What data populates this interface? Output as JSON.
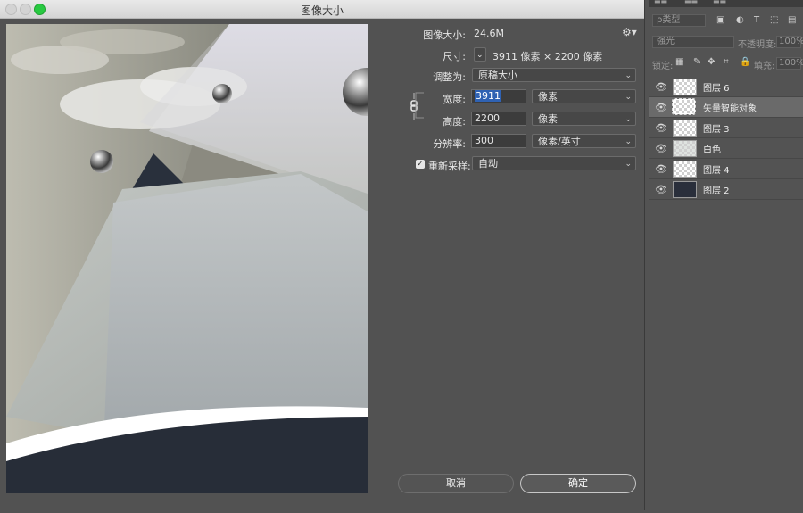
{
  "dialog": {
    "title": "图像大小",
    "image_size_label": "图像大小:",
    "image_size_value": "24.6M",
    "dimensions_label": "尺寸:",
    "dimensions_value": "3911 像素  ×  2200 像素",
    "fit_to_label": "调整为:",
    "fit_to_value": "原稿大小",
    "width_label": "宽度:",
    "width_value": "3911",
    "width_unit": "像素",
    "height_label": "高度:",
    "height_value": "2200",
    "height_unit": "像素",
    "resolution_label": "分辨率:",
    "resolution_value": "300",
    "resolution_unit": "像素/英寸",
    "resample_label": "重新采样:",
    "resample_checked": true,
    "resample_value": "自动",
    "cancel_label": "取消",
    "ok_label": "确定"
  },
  "layers_panel": {
    "filter_kind": "ρ类型",
    "blend_mode": "强光",
    "opacity_label": "不透明度:",
    "opacity_value": "100%",
    "lock_label": "锁定:",
    "fill_label": "填充:",
    "fill_value": "100%",
    "layers": [
      {
        "name": "图层 6",
        "thumb": "transparent",
        "active": false
      },
      {
        "name": "矢量智能对象",
        "thumb": "transparent",
        "active": true
      },
      {
        "name": "图层 3",
        "thumb": "transparent",
        "active": false
      },
      {
        "name": "白色",
        "thumb": "paint",
        "active": false
      },
      {
        "name": "图层 4",
        "thumb": "transparent",
        "active": false
      },
      {
        "name": "图层 2",
        "thumb": "dark",
        "active": false
      }
    ]
  },
  "colors": {
    "dialog_bg": "#525252",
    "highlight": "#2f62b3",
    "maximize_green": "#28c941"
  }
}
